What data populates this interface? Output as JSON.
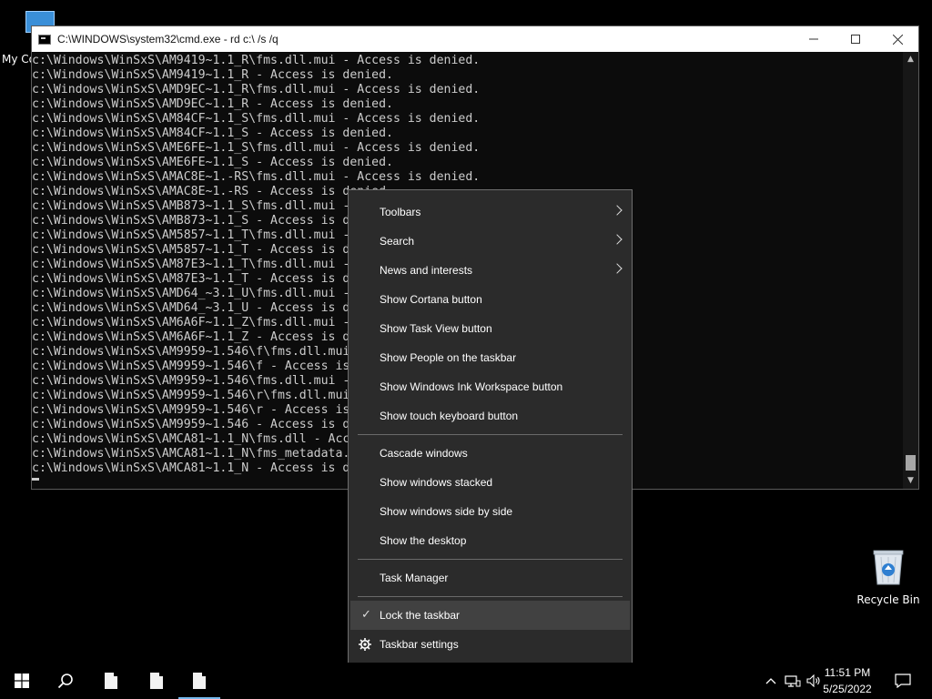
{
  "desktop": {
    "my_computer_label": "My Co",
    "recycle_bin_label": "Recycle Bin"
  },
  "cmd": {
    "title": "C:\\WINDOWS\\system32\\cmd.exe - rd  c:\\ /s /q",
    "lines": [
      "c:\\Windows\\WinSxS\\AM9419~1.1_R\\fms.dll.mui - Access is denied.",
      "c:\\Windows\\WinSxS\\AM9419~1.1_R - Access is denied.",
      "c:\\Windows\\WinSxS\\AMD9EC~1.1_R\\fms.dll.mui - Access is denied.",
      "c:\\Windows\\WinSxS\\AMD9EC~1.1_R - Access is denied.",
      "c:\\Windows\\WinSxS\\AM84CF~1.1_S\\fms.dll.mui - Access is denied.",
      "c:\\Windows\\WinSxS\\AM84CF~1.1_S - Access is denied.",
      "c:\\Windows\\WinSxS\\AME6FE~1.1_S\\fms.dll.mui - Access is denied.",
      "c:\\Windows\\WinSxS\\AME6FE~1.1_S - Access is denied.",
      "c:\\Windows\\WinSxS\\AMAC8E~1.-RS\\fms.dll.mui - Access is denied.",
      "c:\\Windows\\WinSxS\\AMAC8E~1.-RS - Access is denied.",
      "c:\\Windows\\WinSxS\\AMB873~1.1_S\\fms.dll.mui -",
      "c:\\Windows\\WinSxS\\AMB873~1.1_S - Access is d",
      "c:\\Windows\\WinSxS\\AM5857~1.1_T\\fms.dll.mui -",
      "c:\\Windows\\WinSxS\\AM5857~1.1_T - Access is d",
      "c:\\Windows\\WinSxS\\AM87E3~1.1_T\\fms.dll.mui -",
      "c:\\Windows\\WinSxS\\AM87E3~1.1_T - Access is d",
      "c:\\Windows\\WinSxS\\AMD64_~3.1_U\\fms.dll.mui -",
      "c:\\Windows\\WinSxS\\AMD64_~3.1_U - Access is d",
      "c:\\Windows\\WinSxS\\AM6A6F~1.1_Z\\fms.dll.mui -",
      "c:\\Windows\\WinSxS\\AM6A6F~1.1_Z - Access is d",
      "c:\\Windows\\WinSxS\\AM9959~1.546\\f\\fms.dll.mui",
      "c:\\Windows\\WinSxS\\AM9959~1.546\\f - Access is",
      "c:\\Windows\\WinSxS\\AM9959~1.546\\fms.dll.mui -",
      "c:\\Windows\\WinSxS\\AM9959~1.546\\r\\fms.dll.mui",
      "c:\\Windows\\WinSxS\\AM9959~1.546\\r - Access is",
      "c:\\Windows\\WinSxS\\AM9959~1.546 - Access is d",
      "c:\\Windows\\WinSxS\\AMCA81~1.1_N\\fms.dll - Acc",
      "c:\\Windows\\WinSxS\\AMCA81~1.1_N\\fms_metadata.",
      "c:\\Windows\\WinSxS\\AMCA81~1.1_N - Access is d"
    ]
  },
  "context_menu": {
    "groups": [
      [
        {
          "label": "Toolbars",
          "submenu": true
        },
        {
          "label": "Search",
          "submenu": true
        },
        {
          "label": "News and interests",
          "submenu": true
        },
        {
          "label": "Show Cortana button"
        },
        {
          "label": "Show Task View button"
        },
        {
          "label": "Show People on the taskbar"
        },
        {
          "label": "Show Windows Ink Workspace button"
        },
        {
          "label": "Show touch keyboard button"
        }
      ],
      [
        {
          "label": "Cascade windows"
        },
        {
          "label": "Show windows stacked"
        },
        {
          "label": "Show windows side by side"
        },
        {
          "label": "Show the desktop"
        }
      ],
      [
        {
          "label": "Task Manager"
        }
      ],
      [
        {
          "label": "Lock the taskbar",
          "checked": true,
          "hover": true
        },
        {
          "label": "Taskbar settings",
          "icon": "gear-icon"
        }
      ]
    ]
  },
  "taskbar": {
    "time": "11:51 PM",
    "date": "5/25/2022",
    "accent_color": "#76b9ed"
  }
}
